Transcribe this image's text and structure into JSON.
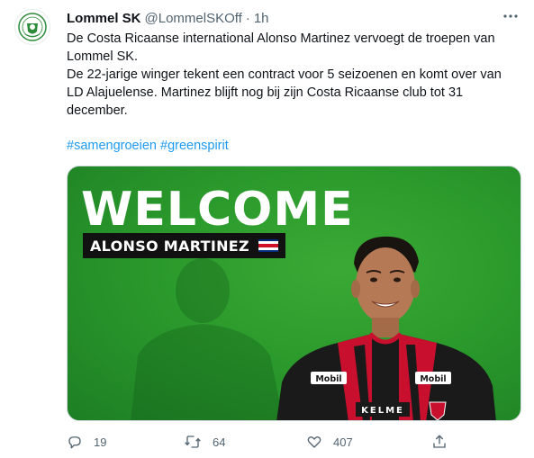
{
  "tweet": {
    "display_name": "Lommel SK",
    "handle": "@LommelSKOff",
    "separator": "·",
    "time": "1h",
    "paragraphs": [
      "De Costa Ricaanse international Alonso Martinez vervoegt de troepen van Lommel SK.",
      "De 22-jarige winger tekent een contract voor 5 seizoenen en komt over van LD Alajuelense. Martinez blijft nog bij zijn Costa Ricaanse club tot 31 december."
    ],
    "hashtags": [
      "#samengroeien",
      "#greenspirit"
    ],
    "avatar_icon": "lommel-sk-crest-icon",
    "more_icon": "more-horizontal-icon"
  },
  "media": {
    "headline": "WELCOME",
    "player_name": "ALONSO MARTINEZ",
    "flag_icon": "costa-rica-flag-icon",
    "shirt_sponsor": "Mobil",
    "shirt_brand": "KELME",
    "colors": {
      "green": "#2b9a2c",
      "banner": "#111111",
      "shirt_red": "#c8102e",
      "shirt_black": "#1a1a1a"
    }
  },
  "actions": {
    "reply": {
      "icon": "reply-icon",
      "count": "19"
    },
    "retweet": {
      "icon": "retweet-icon",
      "count": "64"
    },
    "like": {
      "icon": "heart-icon",
      "count": "407"
    },
    "share": {
      "icon": "share-icon"
    }
  },
  "colors": {
    "link": "#1d9bf0",
    "secondary_text": "#536471",
    "primary_text": "#0f1419"
  }
}
